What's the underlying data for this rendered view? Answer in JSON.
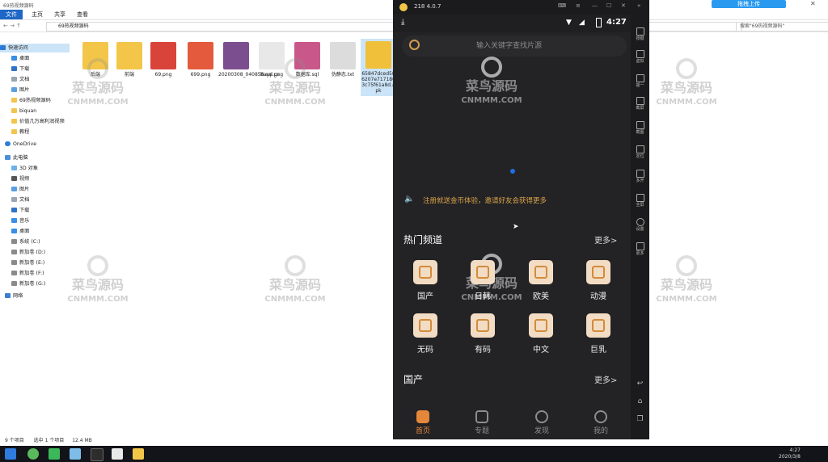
{
  "explorer": {
    "title": "69热视频源码",
    "tabs": [
      "文件",
      "主页",
      "共享",
      "查看"
    ],
    "address": "69热视频源码",
    "search_placeholder": "搜索\"69热视频源码\"",
    "sidebar": [
      {
        "label": "快速访问",
        "selected": true
      },
      {
        "label": "桌面"
      },
      {
        "label": "下载"
      },
      {
        "label": "文档"
      },
      {
        "label": "图片"
      },
      {
        "label": "69热视频源码"
      },
      {
        "label": "biquan"
      },
      {
        "label": "价值几万高利润视频"
      },
      {
        "label": "教程"
      },
      {
        "label": "OneDrive"
      },
      {
        "label": "此电脑"
      },
      {
        "label": "3D 对象"
      },
      {
        "label": "视频"
      },
      {
        "label": "图片"
      },
      {
        "label": "文档"
      },
      {
        "label": "下载"
      },
      {
        "label": "音乐"
      },
      {
        "label": "桌面"
      },
      {
        "label": "系统 (C:)"
      },
      {
        "label": "新加卷 (D:)"
      },
      {
        "label": "新加卷 (E:)"
      },
      {
        "label": "新加卷 (F:)"
      },
      {
        "label": "新加卷 (G:)"
      },
      {
        "label": "网络"
      }
    ],
    "files": [
      {
        "name": "后端",
        "color": "#f3c64a"
      },
      {
        "name": "前端",
        "color": "#f3c64a"
      },
      {
        "name": "69.png",
        "color": "#d9443a"
      },
      {
        "name": "699.png",
        "color": "#e35a3c"
      },
      {
        "name": "20200308_040858.sql.gz",
        "color": "#7b4f8f"
      },
      {
        "name": "baye.png",
        "color": "#e8e8e8"
      },
      {
        "name": "数据库.sql",
        "color": "#c9588a"
      },
      {
        "name": "伪静态.txt",
        "color": "#dcdcdc"
      },
      {
        "name": "65847dced586207e7171803c75f61a8d.apk",
        "color": "#f0c03a"
      }
    ],
    "status": {
      "count": "9 个项目",
      "selected": "选中 1 个项目",
      "size": "12.4 MB"
    }
  },
  "emulator": {
    "version": "218 4.0.7",
    "time": "4:27",
    "search_placeholder": "输入关键字查找片源",
    "announcement": "注册就送金币体验，邀请好友会获得更多",
    "section1": {
      "title": "热门频道",
      "more": "更多>"
    },
    "categories": [
      "国产",
      "日韩",
      "欧美",
      "动漫",
      "无码",
      "有码",
      "中文",
      "巨乳"
    ],
    "section2": {
      "title": "国产",
      "more": "更多>"
    },
    "bottom_nav": [
      {
        "label": "首页",
        "active": true
      },
      {
        "label": "专题"
      },
      {
        "label": "发现"
      },
      {
        "label": "我的"
      }
    ],
    "side_panel": [
      "按键",
      "虚拟",
      "摇一",
      "截屏",
      "截图",
      "定位",
      "多开",
      "全屏",
      "设置",
      "更多"
    ]
  },
  "watermark": {
    "text": "菜鸟源码",
    "sub": "CNMMM.COM"
  },
  "top_right_button": "拖拽上传",
  "taskbar": {
    "time": "4:27",
    "date": "2020/3/8"
  }
}
